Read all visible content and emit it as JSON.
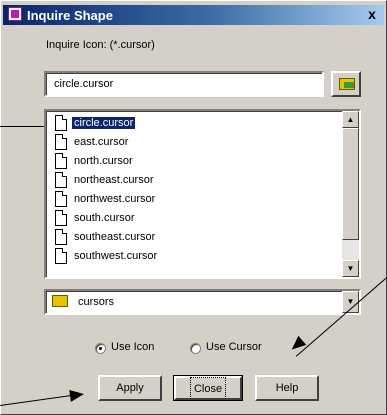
{
  "window": {
    "title": "Inquire Shape",
    "close_glyph": "x"
  },
  "inquire": {
    "label": "Inquire Icon: (*.cursor)",
    "value": "circle.cursor",
    "browse_icon": "folder-open-icon"
  },
  "file_list": {
    "items": [
      {
        "label": "circle.cursor",
        "selected": true
      },
      {
        "label": "east.cursor",
        "selected": false
      },
      {
        "label": "north.cursor",
        "selected": false
      },
      {
        "label": "northeast.cursor",
        "selected": false
      },
      {
        "label": "northwest.cursor",
        "selected": false
      },
      {
        "label": "south.cursor",
        "selected": false
      },
      {
        "label": "southeast.cursor",
        "selected": false
      },
      {
        "label": "southwest.cursor",
        "selected": false
      }
    ]
  },
  "folder_select": {
    "value": "cursors",
    "icon": "folder-icon"
  },
  "mode": {
    "use_icon_label": "Use Icon",
    "use_cursor_label": "Use Cursor",
    "selected": "use_icon"
  },
  "buttons": {
    "apply": "Apply",
    "close": "Close",
    "help": "Help"
  },
  "colors": {
    "dialog_bg": "#d4d0c8",
    "title_bar": "#0a246a",
    "selection": "#0a246a"
  }
}
